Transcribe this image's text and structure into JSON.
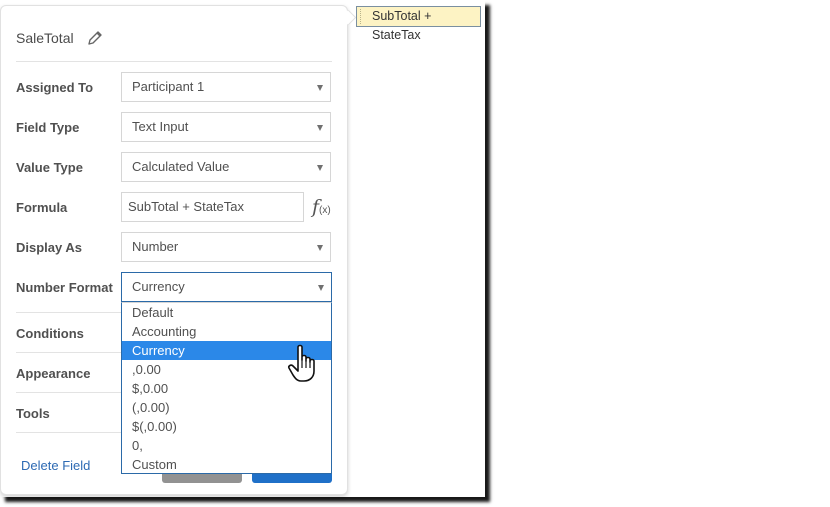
{
  "tooltip": {
    "text": "SubTotal + StateTax"
  },
  "panel": {
    "title": "SaleTotal",
    "title_icon": "pencil-icon",
    "fields": [
      {
        "label": "Assigned To",
        "value": "Participant 1",
        "type": "select"
      },
      {
        "label": "Field Type",
        "value": "Text Input",
        "type": "select"
      },
      {
        "label": "Value Type",
        "value": "Calculated Value",
        "type": "select"
      },
      {
        "label": "Formula",
        "value": "SubTotal + StateTax",
        "type": "text",
        "icon": "function-fx-icon"
      },
      {
        "label": "Display As",
        "value": "Number",
        "type": "select"
      },
      {
        "label": "Number Format",
        "value": "Currency",
        "type": "select",
        "open": true
      }
    ],
    "sections": [
      "Conditions",
      "Appearance",
      "Tools"
    ],
    "delete_label": "Delete Field",
    "fx_label": "f",
    "fx_sub": "(x)"
  },
  "number_format_options": {
    "items": [
      "Default",
      "Accounting",
      "Currency",
      ",0.00",
      "$,0.00",
      "(,0.00)",
      "$(,0.00)",
      "0,",
      "Custom"
    ],
    "selected": "Currency"
  },
  "colors": {
    "accent": "#2b88e8",
    "link": "#2d6ab3",
    "primary_button": "#1f70c8",
    "secondary_button": "#929292",
    "tooltip_bg": "#fdf3c4"
  }
}
